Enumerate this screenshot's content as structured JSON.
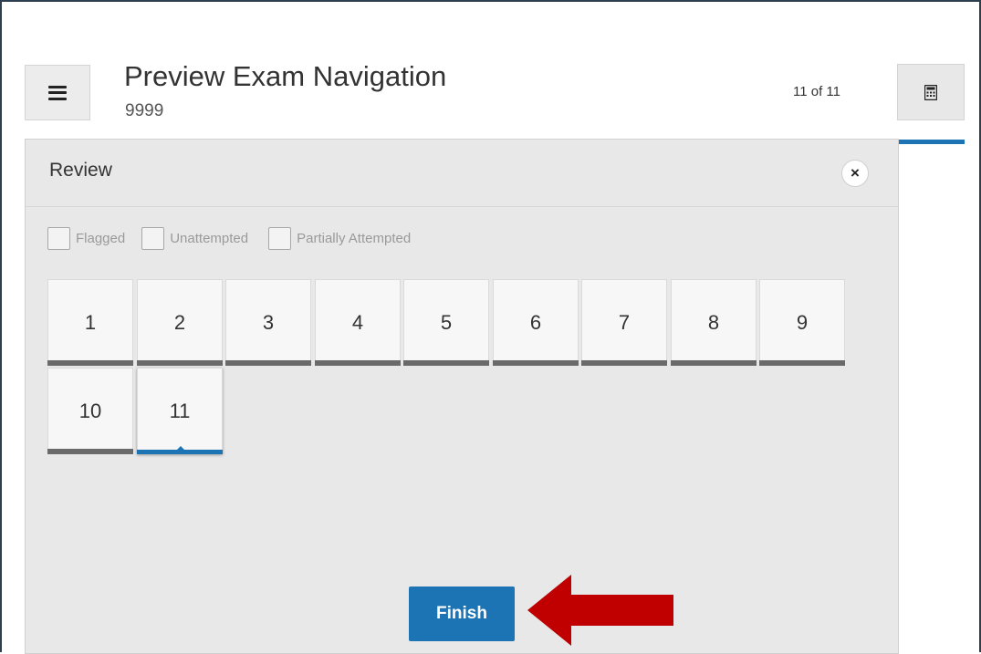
{
  "header": {
    "title": "Preview Exam Navigation",
    "subtitle": "9999",
    "page_count": "11 of 11"
  },
  "review": {
    "title": "Review",
    "close_label": "×",
    "filters": [
      {
        "label": "Flagged",
        "checked": false
      },
      {
        "label": "Unattempted",
        "checked": false
      },
      {
        "label": "Partially Attempted",
        "checked": false
      }
    ],
    "questions": [
      "1",
      "2",
      "3",
      "4",
      "5",
      "6",
      "7",
      "8",
      "9",
      "10",
      "11"
    ],
    "current_question": "11",
    "finish_label": "Finish"
  },
  "icons": {
    "menu": "hamburger-menu-icon",
    "calculator": "calculator-icon",
    "close": "close-icon",
    "annotation": "red-arrow-pointer"
  },
  "colors": {
    "accent": "#1d74b5",
    "status_bar": "#6a6a6a",
    "annotation_arrow": "#c00000"
  }
}
